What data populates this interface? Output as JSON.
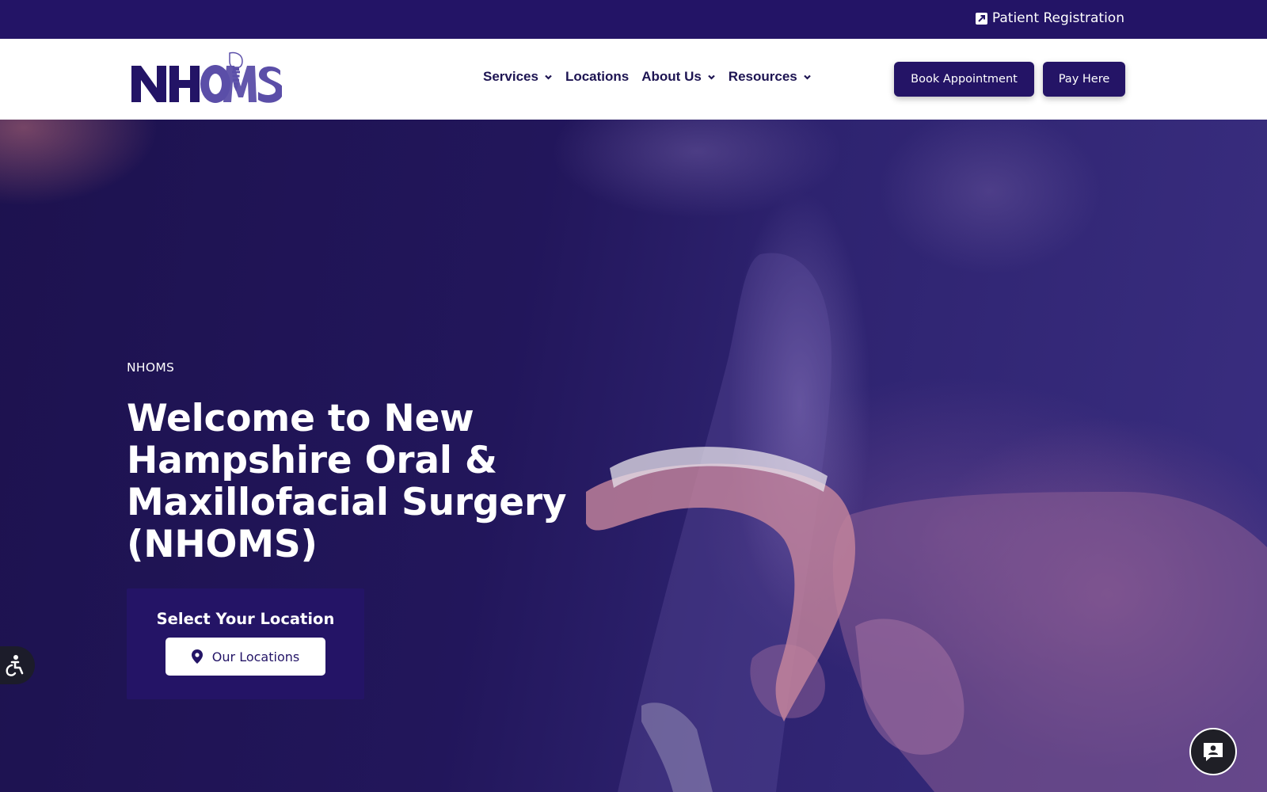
{
  "topbar": {
    "registration_label": "Patient Registration",
    "registration_icon": "external-link-icon"
  },
  "header": {
    "logo_text": "NHOMS",
    "nav": [
      {
        "label": "Services",
        "has_dropdown": true
      },
      {
        "label": "Locations",
        "has_dropdown": false
      },
      {
        "label": "About Us",
        "has_dropdown": true
      },
      {
        "label": "Resources",
        "has_dropdown": true
      }
    ],
    "book_label": "Book Appointment",
    "pay_label": "Pay Here"
  },
  "hero": {
    "eyebrow": "NHOMS",
    "headline": "Welcome to New Hampshire Oral & Maxillofacial Surgery (NHOMS)",
    "location_card": {
      "title": "Select Your Location",
      "button_label": "Our Locations",
      "button_icon": "map-pin-icon"
    }
  },
  "widgets": {
    "accessibility_icon": "accessibility-icon",
    "chat_icon": "chat-contact-icon"
  },
  "colors": {
    "brand_dark": "#231466",
    "logo_purple": "#5b4ea8",
    "white": "#ffffff"
  }
}
